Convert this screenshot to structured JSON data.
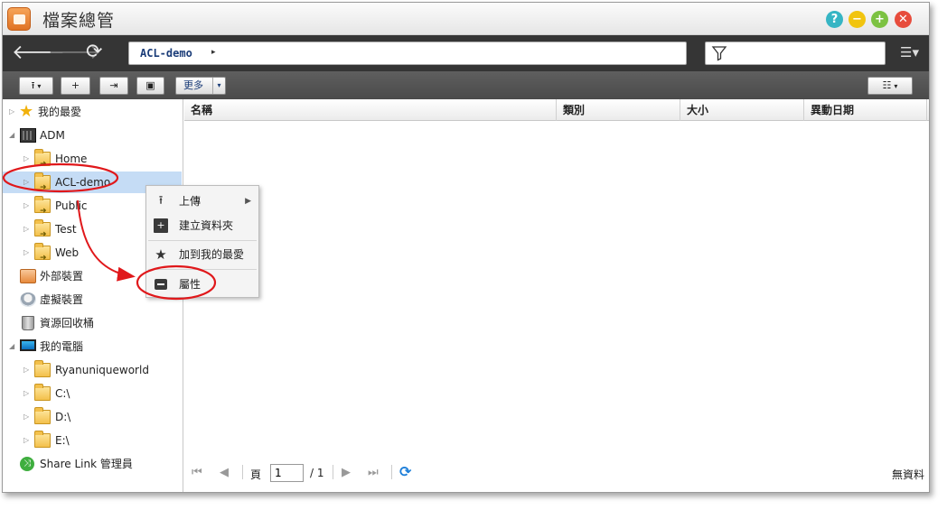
{
  "window": {
    "title": "檔案總管",
    "help": "?",
    "min": "−",
    "max": "+",
    "close": "✕"
  },
  "nav": {
    "back": "🡐",
    "forward": "🡒",
    "refresh": "⟳",
    "path": "ACL-demo",
    "path_arrow": "▸",
    "filter_placeholder": "",
    "menu": "☰▾"
  },
  "toolbar": {
    "upload": "⭱",
    "new_folder": "+",
    "move": "⇥",
    "select": "▣",
    "more": "更多",
    "more_caret": "▾",
    "view": "☷",
    "view_caret": "▾"
  },
  "sidebar": {
    "items": [
      {
        "label": "我的最愛",
        "icon": "star-icon"
      },
      {
        "label": "ADM",
        "icon": "server-icon"
      },
      {
        "label": "Home",
        "icon": "shared-folder-icon"
      },
      {
        "label": "ACL-demo",
        "icon": "shared-folder-icon"
      },
      {
        "label": "Public",
        "icon": "shared-folder-icon"
      },
      {
        "label": "Test",
        "icon": "shared-folder-icon"
      },
      {
        "label": "Web",
        "icon": "shared-folder-icon"
      },
      {
        "label": "外部裝置",
        "icon": "external-device-icon"
      },
      {
        "label": "虛擬裝置",
        "icon": "virtual-device-icon"
      },
      {
        "label": "資源回收桶",
        "icon": "recycle-bin-icon"
      },
      {
        "label": "我的電腦",
        "icon": "computer-icon"
      },
      {
        "label": "Ryanuniqueworld",
        "icon": "folder-icon"
      },
      {
        "label": "C:\\",
        "icon": "folder-icon"
      },
      {
        "label": "D:\\",
        "icon": "folder-icon"
      },
      {
        "label": "E:\\",
        "icon": "folder-icon"
      },
      {
        "label": "Share Link 管理員",
        "icon": "share-link-icon"
      }
    ],
    "selected_index": 3
  },
  "grid": {
    "columns": [
      "名稱",
      "類別",
      "大小",
      "異動日期"
    ],
    "rows": []
  },
  "pager": {
    "page_label": "頁",
    "page_value": "1",
    "total": "/ 1",
    "status": "無資料"
  },
  "context_menu": {
    "items": [
      {
        "label": "上傳",
        "icon": "upload-icon",
        "submenu": "▶"
      },
      {
        "label": "建立資料夾",
        "icon": "new-folder-icon"
      },
      {
        "label": "加到我的最愛",
        "icon": "star-icon"
      },
      {
        "label": "屬性",
        "icon": "properties-icon"
      }
    ]
  },
  "colors": {
    "navbar": "#353535",
    "toolbar": "#555555",
    "selected": "#c5dcf5",
    "annotation": "#e0181b",
    "path_text": "#1a3c78"
  }
}
